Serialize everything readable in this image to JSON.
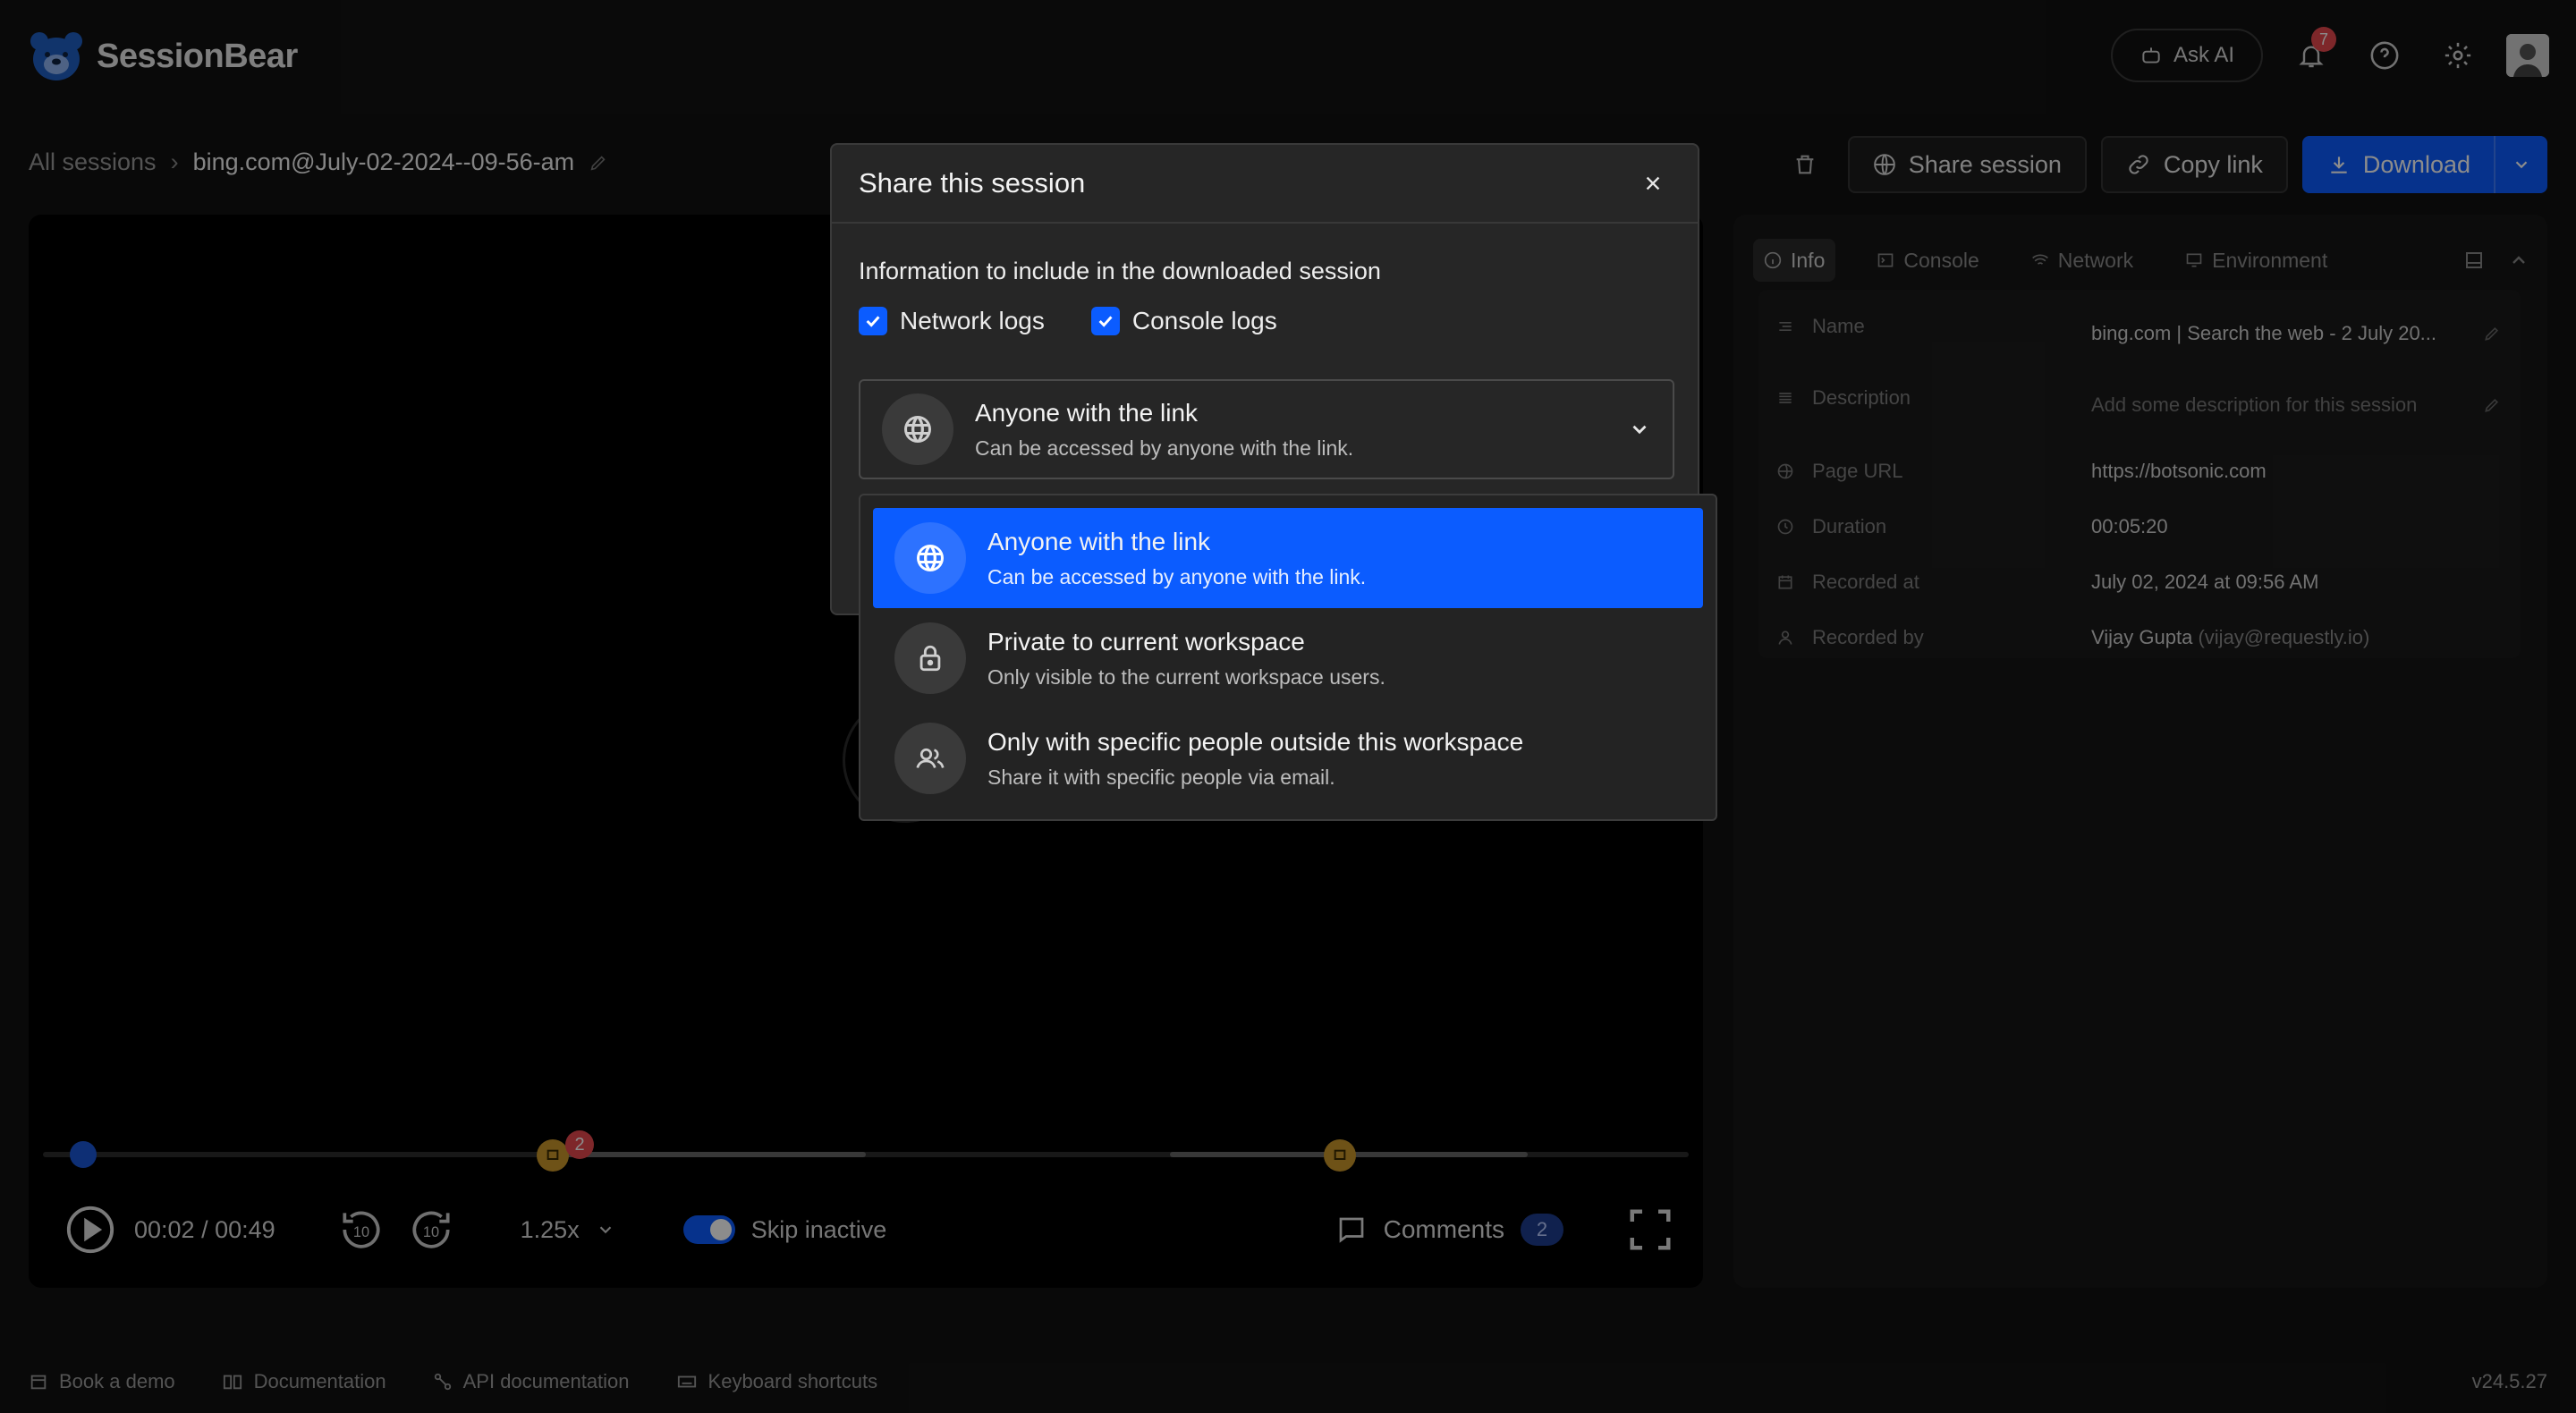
{
  "app": {
    "name": "SessionBear"
  },
  "topbar": {
    "ask_ai": "Ask AI",
    "notification_count": "7"
  },
  "breadcrumb": {
    "all_sessions": "All sessions",
    "current": "bing.com@July-02-2024--09-56-am"
  },
  "actions": {
    "share": "Share session",
    "copy_link": "Copy link",
    "download": "Download"
  },
  "player": {
    "time": "00:02 / 00:49",
    "speed": "1.25x",
    "skip_inactive": "Skip inactive",
    "comments_label": "Comments",
    "comments_count": "2",
    "marker_count": "2"
  },
  "panel": {
    "tabs": [
      "Info",
      "Console",
      "Network",
      "Environment"
    ],
    "info": [
      {
        "key": "Name",
        "value": "bing.com | Search the web - 2 July 20..."
      },
      {
        "key": "Description",
        "value": "Add some description for this session"
      },
      {
        "key": "Page URL",
        "value": "https://botsonic.com"
      },
      {
        "key": "Duration",
        "value": "00:05:20"
      },
      {
        "key": "Recorded at",
        "value": "July 02, 2024 at 09:56 AM"
      },
      {
        "key": "Recorded by",
        "value": "Vijay Gupta",
        "sub": "(vijay@requestly.io)"
      }
    ]
  },
  "footer": {
    "links": [
      "Book a demo",
      "Documentation",
      "API documentation",
      "Keyboard shortcuts"
    ],
    "version": "v24.5.27"
  },
  "modal": {
    "title": "Share this session",
    "include_label": "Information to include in the downloaded session",
    "checkboxes": [
      {
        "label": "Network logs",
        "checked": true
      },
      {
        "label": "Console logs",
        "checked": true
      }
    ],
    "selected": {
      "title": "Anyone with the link",
      "desc": "Can be accessed by anyone with the link.",
      "icon": "globe-icon"
    },
    "options": [
      {
        "title": "Anyone with the link",
        "desc": "Can be accessed by anyone with the link.",
        "icon": "globe-icon",
        "selected": true
      },
      {
        "title": "Private to current workspace",
        "desc": "Only visible to the current workspace users.",
        "icon": "lock-icon",
        "selected": false
      },
      {
        "title": "Only with specific people outside this workspace",
        "desc": "Share it with specific people via email.",
        "icon": "users-icon",
        "selected": false
      }
    ]
  },
  "colors": {
    "accent": "#0b5cff",
    "background": "#121212",
    "modal": "#262626",
    "danger": "#e5484d",
    "marker": "#c9952a"
  }
}
